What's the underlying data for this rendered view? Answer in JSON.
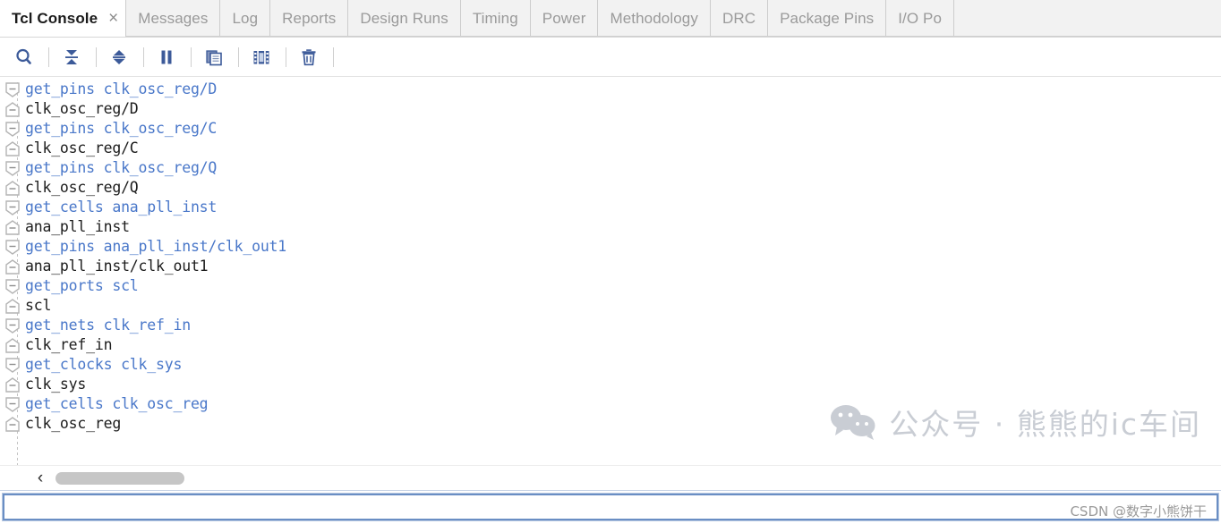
{
  "tabs": [
    {
      "label": "Tcl Console",
      "active": true
    },
    {
      "label": "Messages",
      "active": false
    },
    {
      "label": "Log",
      "active": false
    },
    {
      "label": "Reports",
      "active": false
    },
    {
      "label": "Design Runs",
      "active": false
    },
    {
      "label": "Timing",
      "active": false
    },
    {
      "label": "Power",
      "active": false
    },
    {
      "label": "Methodology",
      "active": false
    },
    {
      "label": "DRC",
      "active": false
    },
    {
      "label": "Package Pins",
      "active": false
    },
    {
      "label": "I/O Po",
      "active": false
    }
  ],
  "tab_close_label": "×",
  "toolbar": {
    "buttons": [
      {
        "name": "search-icon",
        "title": "Search"
      },
      {
        "name": "collapse-all-icon",
        "title": "Collapse All"
      },
      {
        "name": "expand-all-icon",
        "title": "Expand All"
      },
      {
        "name": "pause-icon",
        "title": "Pause"
      },
      {
        "name": "copy-icon",
        "title": "Copy"
      },
      {
        "name": "scroll-lock-icon",
        "title": "Scroll Lock"
      },
      {
        "name": "trash-icon",
        "title": "Clear Console"
      }
    ]
  },
  "console": {
    "lines": [
      {
        "type": "command",
        "text": "get_pins clk_osc_reg/D"
      },
      {
        "type": "result",
        "text": "clk_osc_reg/D"
      },
      {
        "type": "command",
        "text": "get_pins clk_osc_reg/C"
      },
      {
        "type": "result",
        "text": "clk_osc_reg/C"
      },
      {
        "type": "command",
        "text": "get_pins clk_osc_reg/Q"
      },
      {
        "type": "result",
        "text": "clk_osc_reg/Q"
      },
      {
        "type": "command",
        "text": "get_cells ana_pll_inst"
      },
      {
        "type": "result",
        "text": "ana_pll_inst"
      },
      {
        "type": "command",
        "text": "get_pins ana_pll_inst/clk_out1"
      },
      {
        "type": "result",
        "text": "ana_pll_inst/clk_out1"
      },
      {
        "type": "command",
        "text": "get_ports scl"
      },
      {
        "type": "result",
        "text": "scl"
      },
      {
        "type": "command",
        "text": "get_nets clk_ref_in"
      },
      {
        "type": "result",
        "text": "clk_ref_in"
      },
      {
        "type": "command",
        "text": "get_clocks clk_sys"
      },
      {
        "type": "result",
        "text": "clk_sys"
      },
      {
        "type": "command",
        "text": "get_cells clk_osc_reg"
      },
      {
        "type": "result",
        "text": "clk_osc_reg"
      }
    ]
  },
  "scrollbar": {
    "left_arrow": "‹"
  },
  "command_input": {
    "value": "",
    "placeholder": ""
  },
  "watermark": {
    "text": "公众号 · 熊熊的ic车间",
    "credit": "CSDN @数字小熊饼干"
  },
  "colors": {
    "command_text": "#4977c9",
    "result_text": "#1c1c1c",
    "tab_inactive_text": "#9a9a9a",
    "toolbar_icon": "#3c5a99",
    "focus_border": "#6a8ec4"
  }
}
